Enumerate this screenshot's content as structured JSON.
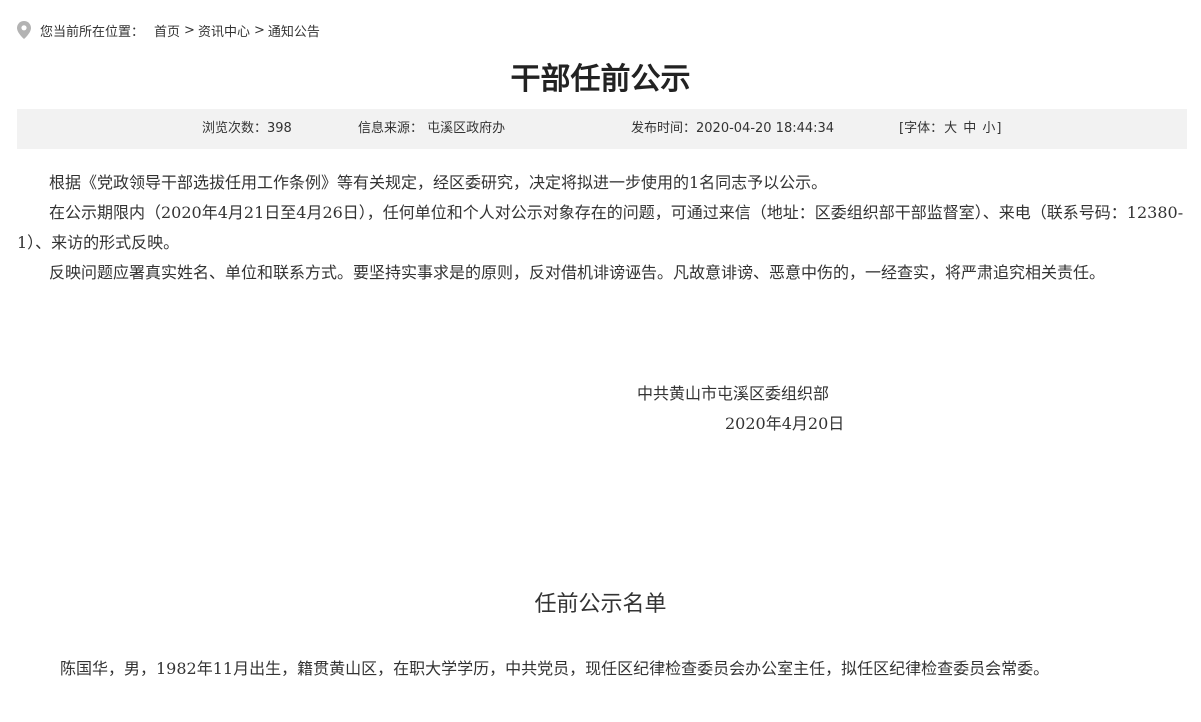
{
  "breadcrumb": {
    "prefix": "您当前所在位置：",
    "home": "首页",
    "sep1": ">",
    "section": "资讯中心",
    "sep2": ">",
    "current": "通知公告"
  },
  "article": {
    "title": "干部任前公示",
    "meta": {
      "views": "浏览次数：398",
      "source": "信息来源： 屯溪区政府办",
      "published": "发布时间：2020-04-20 18:44:34",
      "font_open": "[字体：",
      "font_large": "大",
      "font_medium": "中",
      "font_small": "小",
      "font_close": "]"
    },
    "paragraphs": [
      "根据《党政领导干部选拔任用工作条例》等有关规定，经区委研究，决定将拟进一步使用的1名同志予以公示。",
      "在公示期限内（2020年4月21日至4月26日），任何单位和个人对公示对象存在的问题，可通过来信（地址：区委组织部干部监督室）、来电（联系号码：12380-1）、来访的形式反映。",
      "反映问题应署真实姓名、单位和联系方式。要坚持实事求是的原则，反对借机诽谤诬告。凡故意诽谤、恶意中伤的，一经查实，将严肃追究相关责任。"
    ],
    "signature_org": "中共黄山市屯溪区委组织部",
    "signature_date": "2020年4月20日",
    "list_title": "任前公示名单",
    "list_item": "陈国华，男，1982年11月出生，籍贯黄山区，在职大学学历，中共党员，现任区纪律检查委员会办公室主任，拟任区纪律检查委员会常委。"
  },
  "icons": {
    "location": "location-pin-icon"
  },
  "colors": {
    "meta_bg": "#f2f2f2",
    "text": "#333333",
    "pin": "#b3b3b3"
  }
}
